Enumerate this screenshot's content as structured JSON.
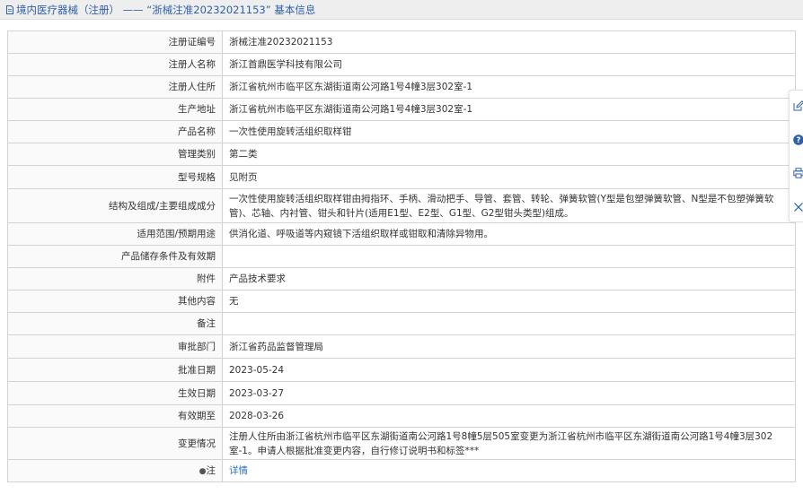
{
  "header": {
    "title": "境内医疗器械（注册） —— “浙械注准20232021153” 基本信息",
    "icon": "document-icon"
  },
  "fields": [
    {
      "label": "注册证编号",
      "value": "浙械注准20232021153"
    },
    {
      "label": "注册人名称",
      "value": "浙江首鼎医学科技有限公司"
    },
    {
      "label": "注册人住所",
      "value": "浙江省杭州市临平区东湖街道南公河路1号4幢3层302室-1"
    },
    {
      "label": "生产地址",
      "value": "浙江省杭州市临平区东湖街道南公河路1号4幢3层302室-1"
    },
    {
      "label": "产品名称",
      "value": "一次性使用旋转活组织取样钳"
    },
    {
      "label": "管理类别",
      "value": "第二类"
    },
    {
      "label": "型号规格",
      "value": "见附页"
    },
    {
      "label": "结构及组成/主要组成成分",
      "value": "一次性使用旋转活组织取样钳由拇指环、手柄、滑动把手、导管、套管、转轮、弹簧软管(Y型是包塑弹簧软管、N型是不包塑弹簧软管)、芯轴、内衬管、钳头和针片(适用E1型、E2型、G1型、G2型钳头类型)组成。"
    },
    {
      "label": "适用范围/预期用途",
      "value": "供消化道、呼吸道等内窥镜下活组织取样或钳取和清除异物用。"
    },
    {
      "label": "产品储存条件及有效期",
      "value": ""
    },
    {
      "label": "附件",
      "value": "产品技术要求"
    },
    {
      "label": "其他内容",
      "value": "无"
    },
    {
      "label": "备注",
      "value": ""
    },
    {
      "label": "审批部门",
      "value": "浙江省药品监督管理局"
    },
    {
      "label": "批准日期",
      "value": "2023-05-24"
    },
    {
      "label": "生效日期",
      "value": "2023-03-27"
    },
    {
      "label": "有效期至",
      "value": "2028-03-26"
    },
    {
      "label": "变更情况",
      "value": "注册人住所由浙江省杭州市临平区东湖街道南公河路1号8幢5层505室变更为浙江省杭州市临平区东湖街道南公河路1号4幢3层302室-1。申请人根据批准变更内容，自行修订说明书和标签***"
    }
  ],
  "note": {
    "label": "注",
    "pin_icon": "pin-icon",
    "link_text": "详情"
  },
  "side_toolbar": {
    "icons": [
      "edit-icon",
      "help-icon",
      "print-icon",
      "close-icon"
    ]
  },
  "colors": {
    "header_bg": "#eeeeee",
    "title_blue": "#2f5fa7",
    "link_blue": "#2f6fc5",
    "label_bg": "#fafafa",
    "border": "#d4d4d4"
  }
}
